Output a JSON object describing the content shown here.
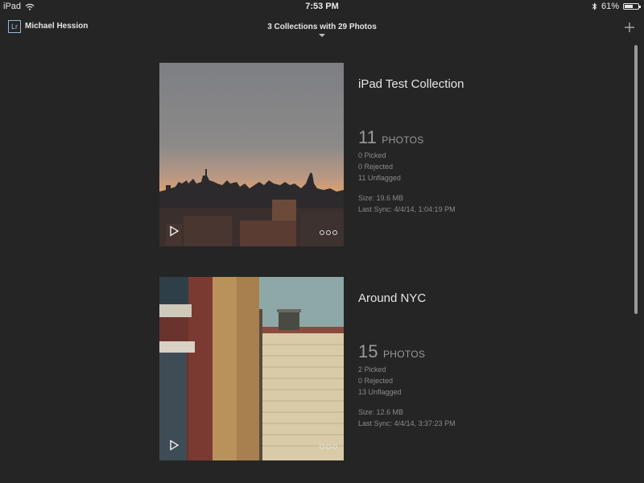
{
  "status_bar": {
    "device": "iPad",
    "time": "7:53 PM",
    "battery_percent": "61%",
    "battery_level": 0.61
  },
  "header": {
    "logo_text": "Lr",
    "user_name": "Michael Hession",
    "title": "3 Collections with 29 Photos"
  },
  "collections": [
    {
      "title": "iPad Test Collection",
      "count": "11",
      "count_unit": "PHOTOS",
      "picked": "0 Picked",
      "rejected": "0 Rejected",
      "unflagged": "11 Unflagged",
      "size": "Size: 19.6 MB",
      "last_sync": "Last Sync: 4/4/14, 1:04:19 PM"
    },
    {
      "title": "Around NYC",
      "count": "15",
      "count_unit": "PHOTOS",
      "picked": "2 Picked",
      "rejected": "0 Rejected",
      "unflagged": "13 Unflagged",
      "size": "Size: 12.6 MB",
      "last_sync": "Last Sync: 4/4/14, 3:37:23 PM"
    }
  ]
}
